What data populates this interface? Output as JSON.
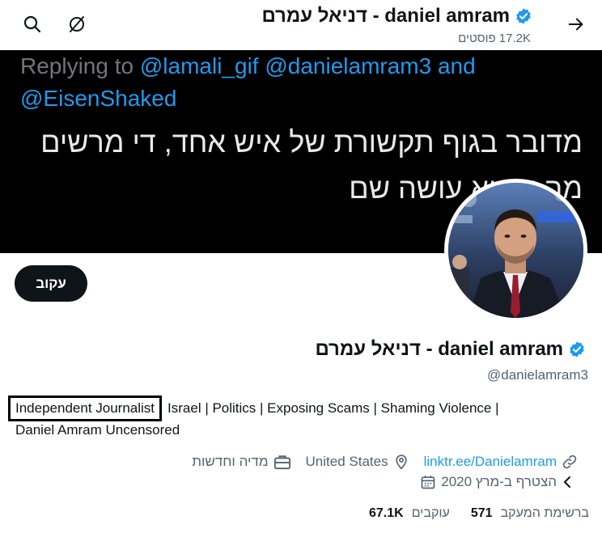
{
  "header": {
    "title": "daniel amram - דניאל עמרם",
    "posts_count": "17.2K פוסטים"
  },
  "banner": {
    "replying_prefix": "Replying to ",
    "mention_1": "@lamali_gif",
    "mention_2": "@danielamram3",
    "and_word": "and",
    "mention_3": "@EisenShaked",
    "hebrew_line_1": "מדובר בגוף תקשורת של איש אחד, די מרשים",
    "hebrew_line_2": "מה שהוא עושה שם"
  },
  "follow_button": {
    "label": "עקוב"
  },
  "profile": {
    "name": "daniel amram - דניאל עמרם",
    "handle": "@danielamram3",
    "bio_highlight": "Independent Journalist",
    "bio_rest": "Israel | Politics | Exposing Scams | Shaming Violence |",
    "bio_line2": "Daniel Amram Uncensored",
    "category": "מדיה וחדשות",
    "location": "United States",
    "link": "linktr.ee/Danielamram",
    "joined": "הצטרף ב-מרץ 2020"
  },
  "stats": {
    "following_count": "571",
    "following_label": "ברשימת המעקב",
    "followers_count": "67.1K",
    "followers_label": "עוקבים"
  },
  "colors": {
    "accent": "#1d9bf0",
    "text_primary": "#0f1419",
    "text_secondary": "#536471",
    "banner_bg": "#000000",
    "follow_bg": "#0f1419"
  },
  "icons": [
    "search-icon",
    "grok-icon",
    "back-arrow-icon",
    "verified-badge-icon",
    "briefcase-icon",
    "location-pin-icon",
    "link-icon",
    "calendar-icon",
    "chevron-left-icon"
  ]
}
